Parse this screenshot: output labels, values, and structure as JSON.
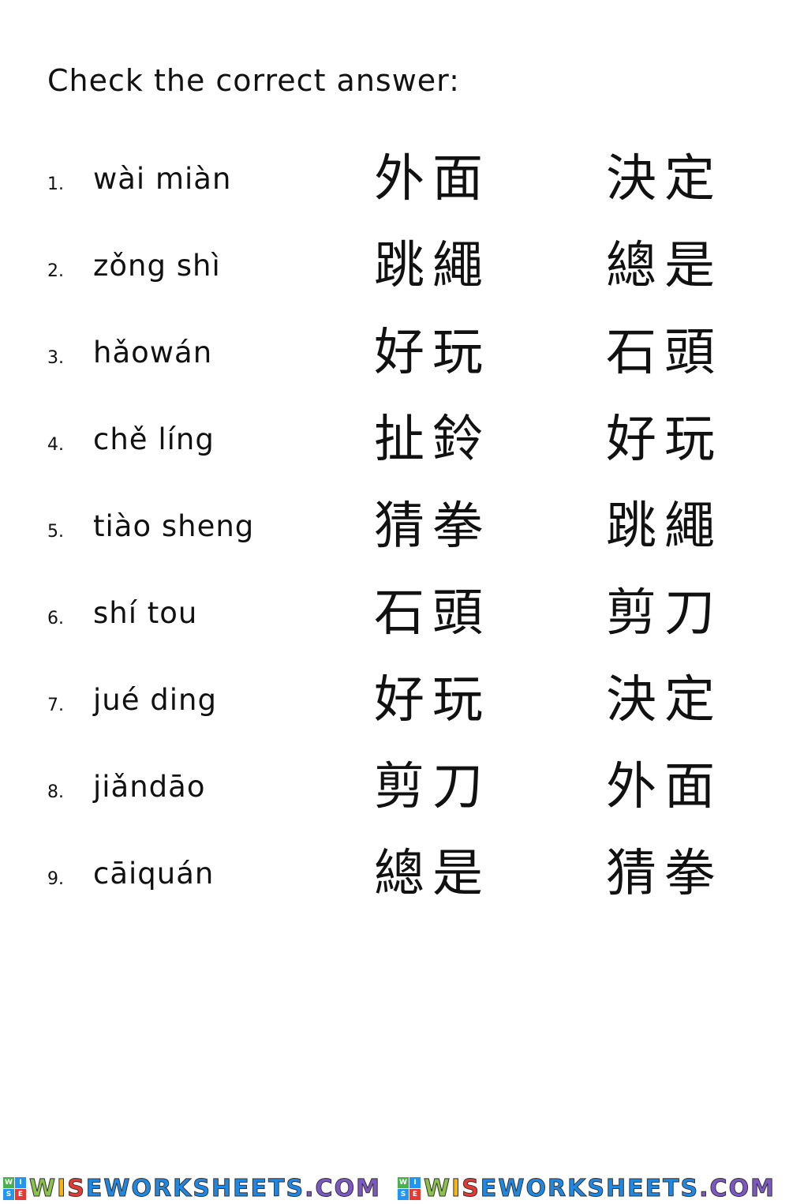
{
  "title": "Check the correct answer:",
  "questions": [
    {
      "number": "1.",
      "pinyin": "wài miàn",
      "options": [
        "外面",
        "決定"
      ]
    },
    {
      "number": "2.",
      "pinyin": "zǒng shì",
      "options": [
        "跳繩",
        "總是"
      ]
    },
    {
      "number": "3.",
      "pinyin": "hǎowán",
      "options": [
        "好玩",
        "石頭"
      ]
    },
    {
      "number": "4.",
      "pinyin": "chě líng",
      "options": [
        "扯鈴",
        "好玩"
      ]
    },
    {
      "number": "5.",
      "pinyin": "tiào sheng",
      "options": [
        "猜拳",
        "跳繩"
      ]
    },
    {
      "number": "6.",
      "pinyin": "shí tou",
      "options": [
        "石頭",
        "剪刀"
      ]
    },
    {
      "number": "7.",
      "pinyin": "jué ding",
      "options": [
        "好玩",
        "決定"
      ]
    },
    {
      "number": "8.",
      "pinyin": "jiǎndāo",
      "options": [
        "剪刀",
        "外面"
      ]
    },
    {
      "number": "9.",
      "pinyin": "cāiquán",
      "options": [
        "總是",
        "猜拳"
      ]
    }
  ],
  "footer": {
    "logo_text": "WISEWORKSHEETS.COM",
    "logo_blocks": [
      "W",
      "I",
      "S",
      "E"
    ],
    "block_colors": [
      "#4caf50",
      "#2196f3",
      "#2196f3",
      "#e53935"
    ],
    "letter_colors": [
      "#8bc34a",
      "#ffb300",
      "#e53935",
      "#1e88e5",
      "#1e88e5",
      "#1e88e5",
      "#1e88e5",
      "#1e88e5",
      "#1e88e5",
      "#1e88e5",
      "#1e88e5",
      "#1e88e5",
      "#1e88e5",
      "#1e88e5",
      "#7e57c2",
      "#7e57c2",
      "#7e57c2",
      "#7e57c2"
    ]
  }
}
